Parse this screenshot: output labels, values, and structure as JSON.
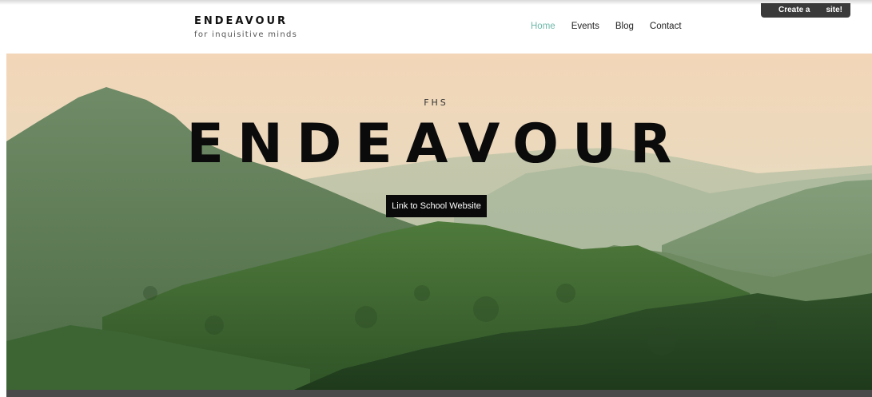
{
  "header": {
    "logo_title": "ENDEAVOUR",
    "logo_tagline": "for inquisitive minds",
    "nav": [
      {
        "label": "Home",
        "active": true
      },
      {
        "label": "Events",
        "active": false
      },
      {
        "label": "Blog",
        "active": false
      },
      {
        "label": "Contact",
        "active": false
      }
    ]
  },
  "create_banner": {
    "left_text": "Create a",
    "right_text": "site!"
  },
  "hero": {
    "kicker": "FHS",
    "title": "ENDEAVOUR",
    "button_label": "Link to School Website"
  },
  "colors": {
    "nav_active": "#6fb7a8",
    "button_bg": "#0a0a0a",
    "banner_bg": "#3a3a3a"
  }
}
